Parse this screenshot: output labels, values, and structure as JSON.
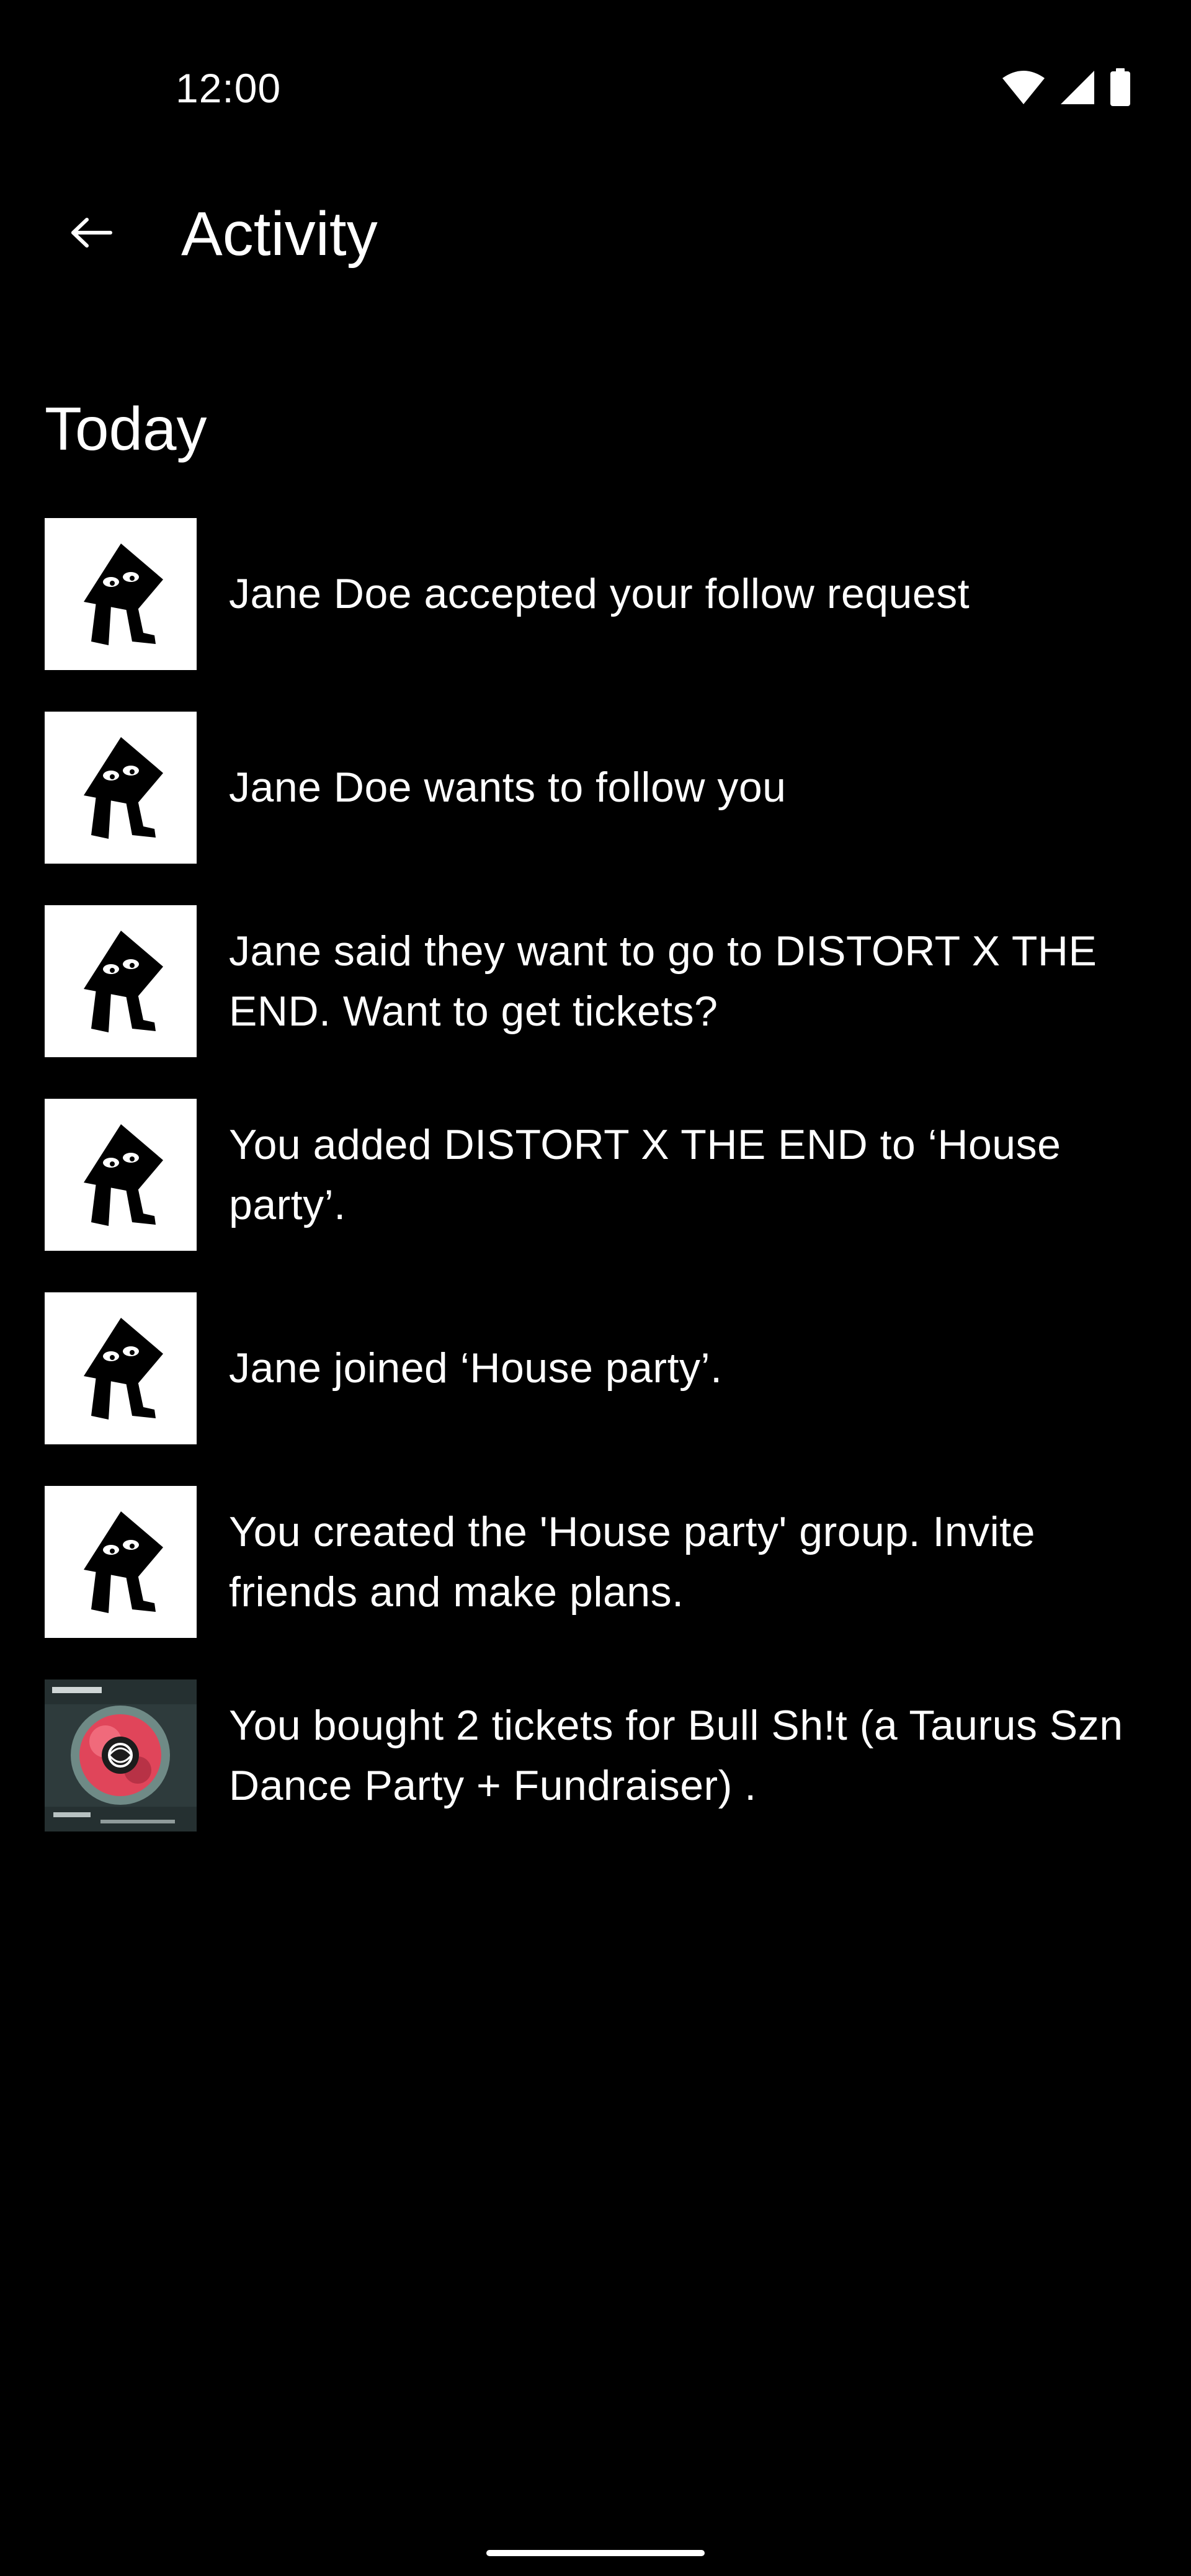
{
  "status_bar": {
    "time": "12:00",
    "icons": [
      "wifi-icon",
      "signal-icon",
      "battery-icon"
    ]
  },
  "app_bar": {
    "back_icon": "arrow-left-icon",
    "title": "Activity"
  },
  "section": {
    "heading": "Today"
  },
  "activities": [
    {
      "thumb": "emoji-character-avatar",
      "text": "Jane Doe accepted your follow request"
    },
    {
      "thumb": "emoji-character-avatar",
      "text": "Jane Doe wants to follow you"
    },
    {
      "thumb": "emoji-character-avatar",
      "text": "Jane said they want to go to DISTORT X THE END. Want to get tickets?"
    },
    {
      "thumb": "emoji-character-avatar",
      "text": "You added DISTORT X THE END to ‘House party’."
    },
    {
      "thumb": "emoji-character-avatar",
      "text": "Jane joined ‘House party’."
    },
    {
      "thumb": "emoji-character-avatar",
      "text": "You created the 'House party' group. Invite friends and make plans."
    },
    {
      "thumb": "event-poster-image",
      "text": "You bought 2 tickets for Bull Sh!t (a Taurus Szn Dance Party + Fundraiser) ."
    }
  ],
  "colors": {
    "background": "#000000",
    "text": "#ffffff",
    "thumb_bg": "#ffffff",
    "poster_red": "#e0455a",
    "poster_teal": "#2e3b3c"
  }
}
